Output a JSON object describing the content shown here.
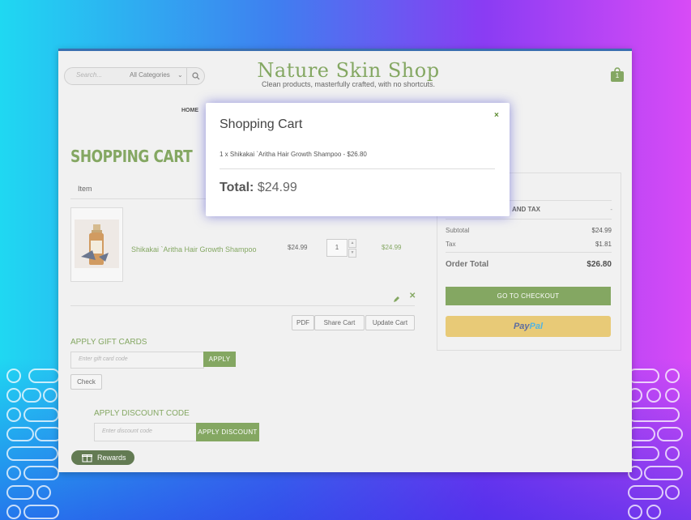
{
  "header": {
    "search_placeholder": "Search...",
    "category_select": "All Categories",
    "logo_title": "Nature Skin Shop",
    "logo_tagline": "Clean products, masterfully crafted, with no shortcuts.",
    "cart_count": "1"
  },
  "nav": {
    "home": "HOME"
  },
  "cart": {
    "title": "SHOPPING CART",
    "item_header": "Item",
    "product_name": "Shikakai `Aritha Hair Growth Shampoo",
    "price": "$24.99",
    "quantity": "1",
    "row_total": "$24.99",
    "buttons": {
      "pdf": "PDF",
      "share": "Share Cart",
      "update": "Update Cart"
    }
  },
  "gift_cards": {
    "label": "APPLY GIFT CARDS",
    "placeholder": "Enter gift card code",
    "apply": "APPLY",
    "check": "Check"
  },
  "discount": {
    "label": "APPLY DISCOUNT CODE",
    "placeholder": "Enter discount code",
    "apply": "APPLY DISCOUNT"
  },
  "rewards": {
    "label": "Rewards"
  },
  "summary": {
    "shipping_heading": "AND TAX",
    "shipping_value": "-",
    "subtotal_label": "Subtotal",
    "subtotal_value": "$24.99",
    "tax_label": "Tax",
    "tax_value": "$1.81",
    "order_total_label": "Order Total",
    "order_total_value": "$26.80",
    "checkout": "GO TO CHECKOUT",
    "paypal_a": "Pay",
    "paypal_b": "Pal"
  },
  "modal": {
    "title": "Shopping Cart",
    "close": "×",
    "line_item": "1 x Shikakai `Aritha Hair Growth Shampoo - $26.80",
    "total_label": "Total:",
    "total_value": "$24.99"
  },
  "colors": {
    "brand_green": "#5b8a2e",
    "paypal_yellow": "#e0b84a"
  }
}
